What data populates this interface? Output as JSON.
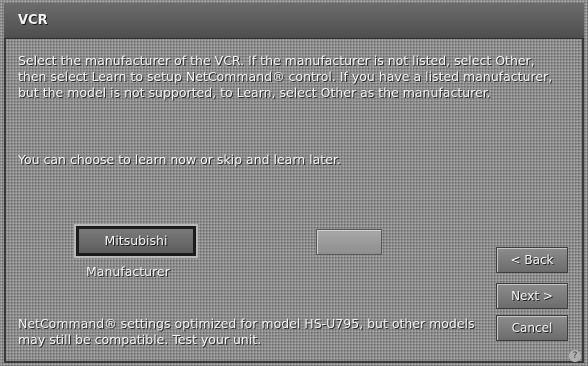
{
  "window": {
    "title": "VCR"
  },
  "instructions": "Select the manufacturer of the VCR. If the manufacturer is not listed, select Other, then select Learn to setup NetCommand® control. If you have a listed manufacturer, but the model is not supported, to Learn, select Other as the manufacturer.",
  "learn_note": "You can choose to learn now or skip and learn later.",
  "manufacturer": {
    "selected": "Mitsubishi",
    "label": "Manufacturer"
  },
  "model": {
    "value": ""
  },
  "buttons": {
    "back": "< Back",
    "next": "Next >",
    "cancel": "Cancel"
  },
  "compat_note": "NetCommand® settings optimized for model HS-U795, but other models may still be compatible. Test your unit.",
  "colors": {
    "background": "#8d8d8d",
    "title_bar": "#5e5e5e",
    "text": "#f4f4f4"
  }
}
